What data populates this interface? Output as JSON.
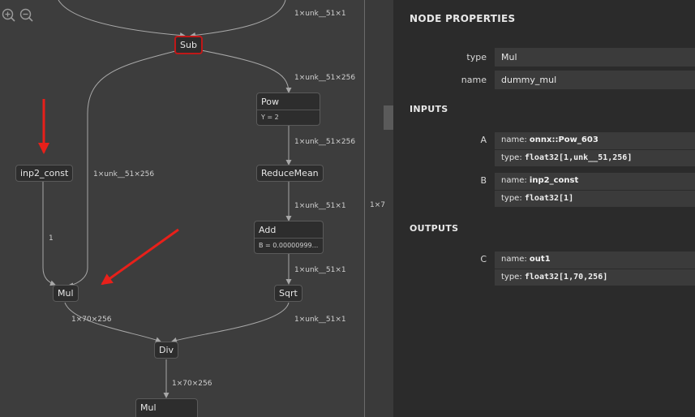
{
  "graph": {
    "zoom_in_icon": "zoom-in-icon",
    "zoom_out_icon": "zoom-out-icon",
    "nodes": {
      "sub": "Sub",
      "pow": {
        "title": "Pow",
        "attr": "Y = 2"
      },
      "reducemean": "ReduceMean",
      "add": {
        "title": "Add",
        "attr": "B = 0.00000999..."
      },
      "sqrt": "Sqrt",
      "inp2_const": "inp2_const",
      "mul": "Mul",
      "div": "Div",
      "mul2": "Mul"
    },
    "edge_labels": {
      "top_sub": "1×unk__51×1",
      "sub_pow": "1×unk__51×256",
      "pow_reducemean": "1×unk__51×256",
      "reducemean_add": "1×unk__51×1",
      "add_sqrt": "1×unk__51×1",
      "sqrt_div": "1×unk__51×1",
      "sub_mul": "1×unk__51×256",
      "const_mul": "1",
      "mul_div": "1×70×256",
      "div_mul2": "1×70×256",
      "strip": "1×7"
    },
    "accent_color": "#e8201a"
  },
  "panel": {
    "title": "NODE PROPERTIES",
    "type_label": "type",
    "type_value": "Mul",
    "name_label": "name",
    "name_value": "dummy_mul",
    "inputs_header": "INPUTS",
    "input_a": {
      "label": "A",
      "name_prefix": "name: ",
      "name": "onnx::Pow_603",
      "type_prefix": "type: ",
      "type": "float32[1,unk__51,256]"
    },
    "input_b": {
      "label": "B",
      "name_prefix": "name: ",
      "name": "inp2_const",
      "type_prefix": "type: ",
      "type": "float32[1]"
    },
    "outputs_header": "OUTPUTS",
    "output_c": {
      "label": "C",
      "name_prefix": "name: ",
      "name": "out1",
      "type_prefix": "type: ",
      "type": "float32[1,70,256]"
    }
  }
}
